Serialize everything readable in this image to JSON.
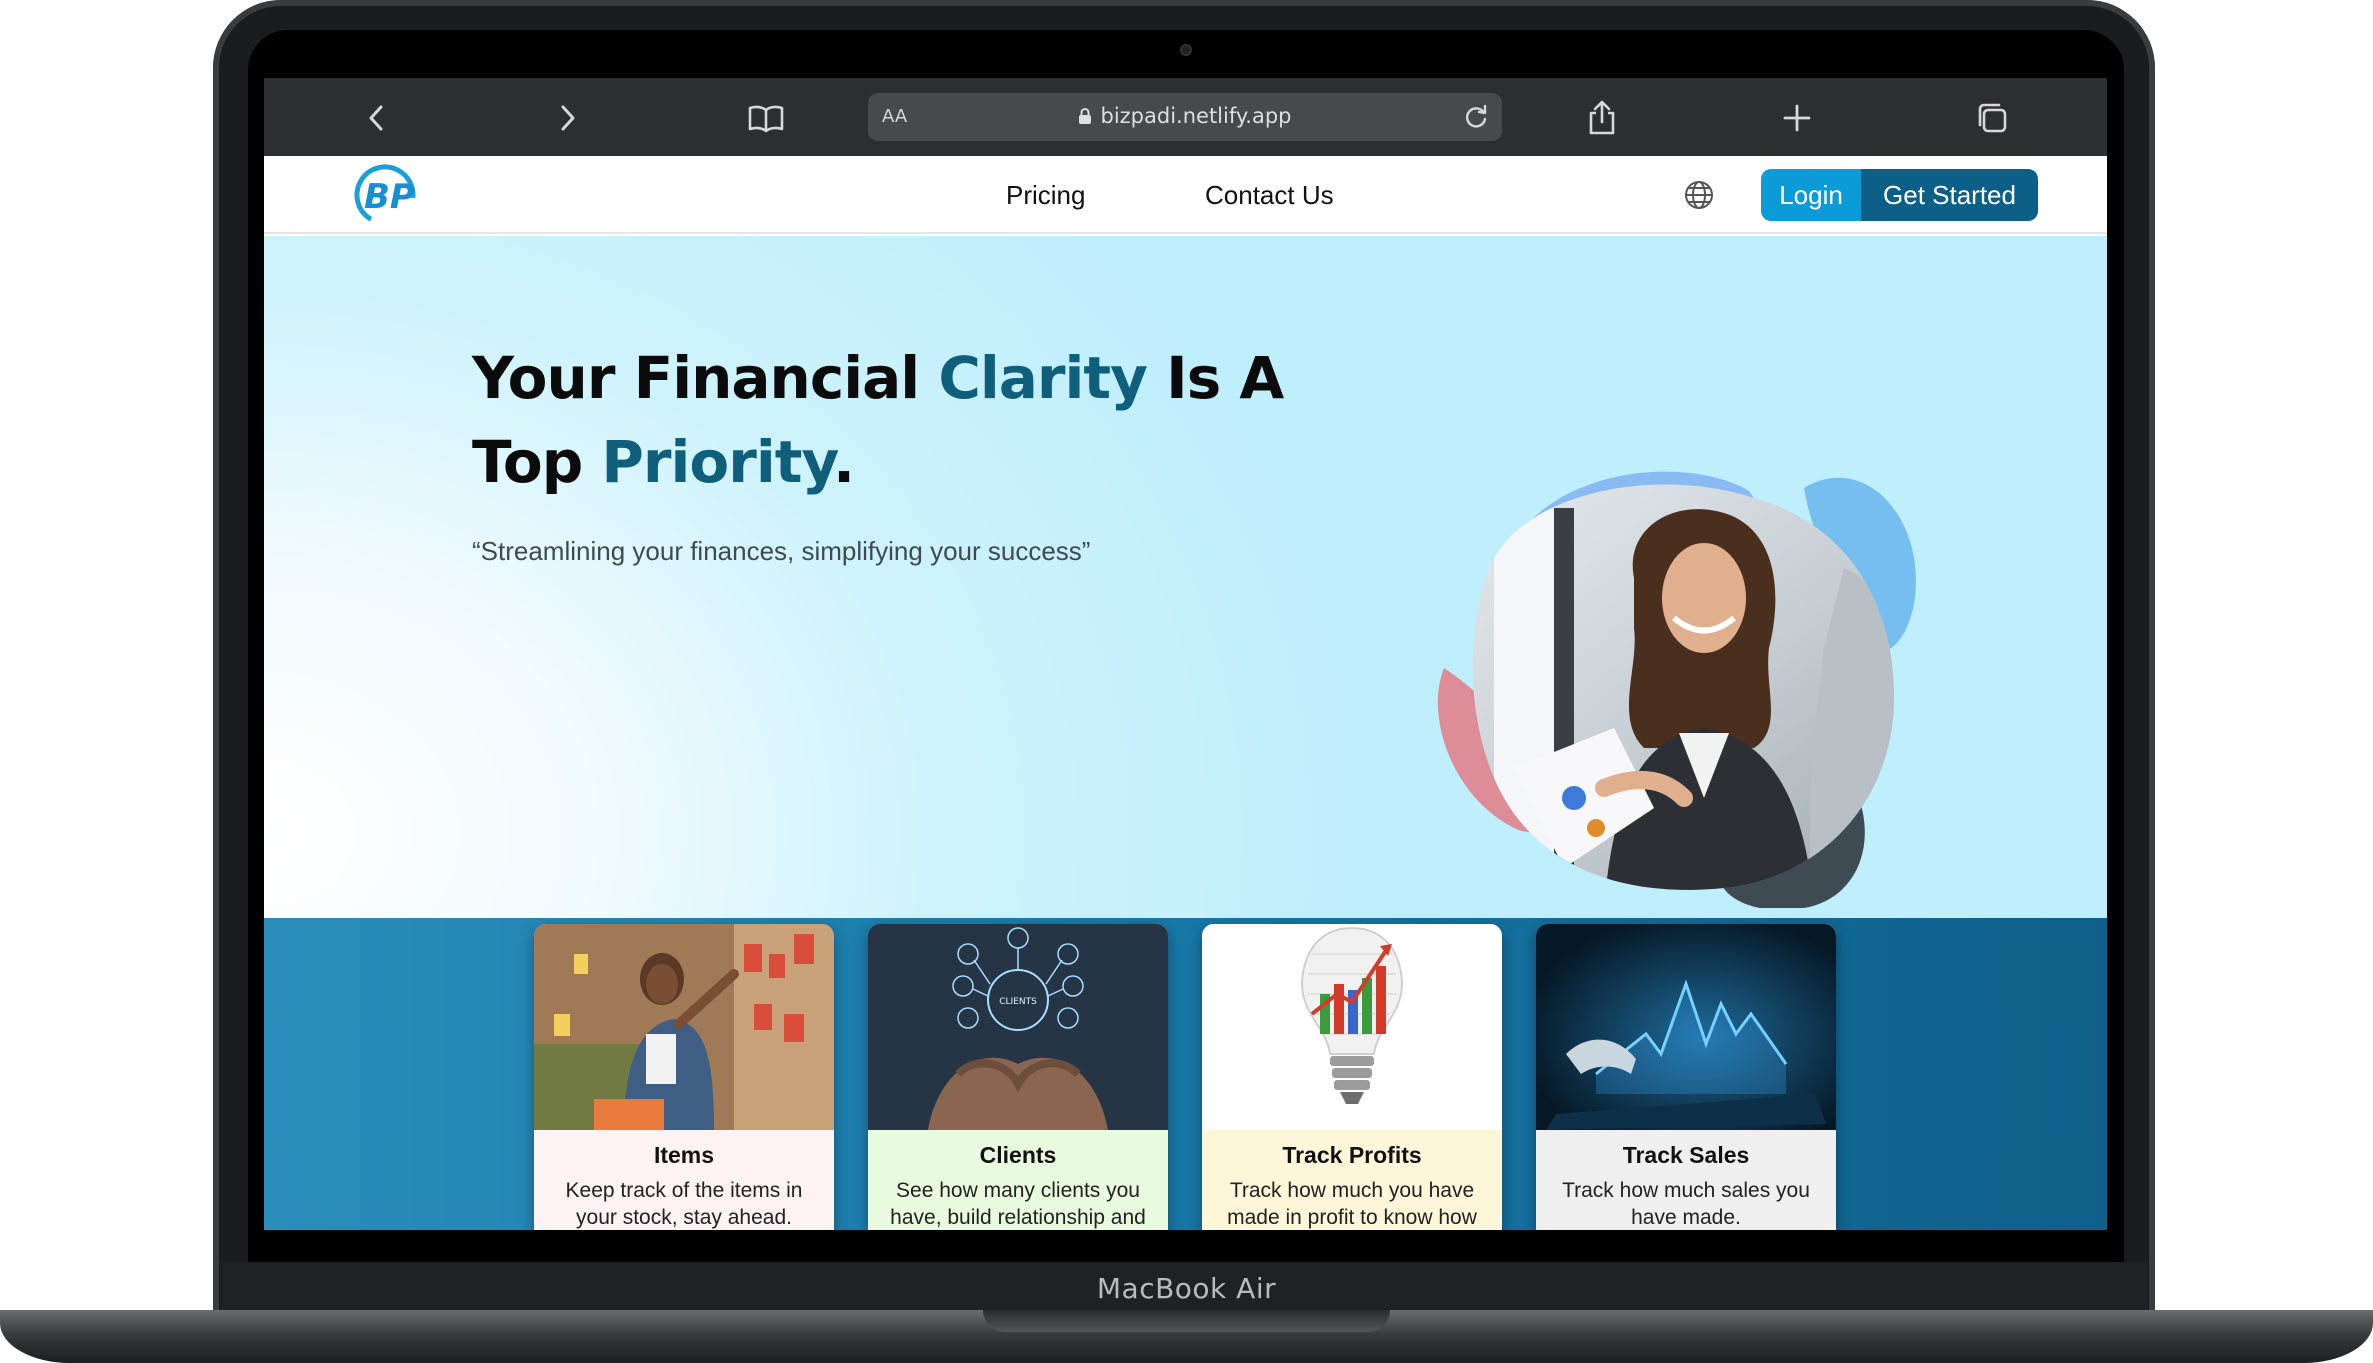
{
  "device": {
    "label": "MacBook Air"
  },
  "browser": {
    "text_size_label": "AA",
    "url": "bizpadi.netlify.app"
  },
  "nav": {
    "logo_text": "BP",
    "links": [
      {
        "label": "Pricing"
      },
      {
        "label": "Contact Us"
      }
    ],
    "login_label": "Login",
    "get_started_label": "Get Started"
  },
  "hero": {
    "title_part1": "Your Financial ",
    "title_accent1": "Clarity",
    "title_part2": " Is A Top ",
    "title_accent2": "Priority",
    "title_end": ".",
    "tagline": "“Streamlining your finances, simplifying your success”"
  },
  "cards": [
    {
      "title": "Items",
      "text": "Keep track of the items in your stock, stay ahead.",
      "bg": "#fdf2f4"
    },
    {
      "title": "Clients",
      "text": "See how many clients you have, build relationship and deliver result.",
      "bg": "#e8fbdf"
    },
    {
      "title": "Track Profits",
      "text": "Track how much you have made in profit to know how to increase profit.",
      "bg": "#fdf6d8"
    },
    {
      "title": "Track Sales",
      "text": "Track how much sales you have made.",
      "bg": "#efefef"
    }
  ],
  "clients_image_label": "CLIENTS",
  "colors": {
    "accent": "#0f5f7c",
    "login_button": "#0b9bd6",
    "get_started_button": "#0c5f86",
    "band": "#1779a8"
  }
}
